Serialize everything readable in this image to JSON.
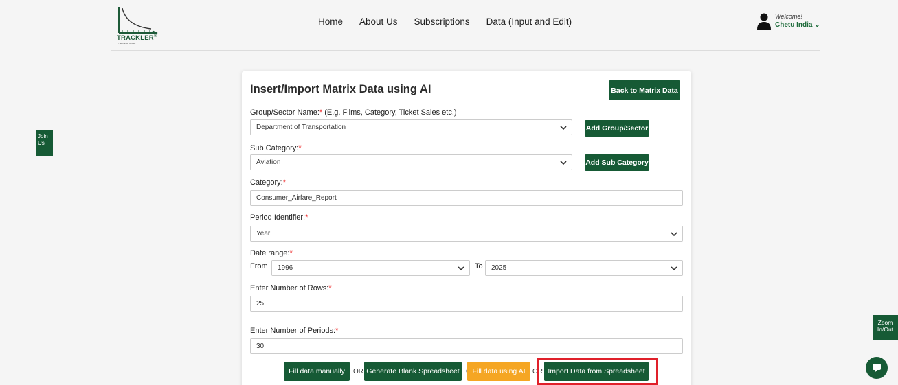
{
  "brand": {
    "logo_text": "TRACKLER",
    "tagline": "The tracker of data"
  },
  "nav": {
    "links": [
      "Home",
      "About Us",
      "Subscriptions",
      "Data (Input and Edit)"
    ]
  },
  "user": {
    "welcome": "Welcome!",
    "name": "Chetu India"
  },
  "side_tabs": {
    "join": "Join Us",
    "zoom": "Zoom In/Out"
  },
  "form": {
    "title": "Insert/Import Matrix Data using AI",
    "back_button": "Back to Matrix Data",
    "group": {
      "label": "Group/Sector Name:",
      "hint": " (E.g. Films, Category, Ticket Sales etc.)",
      "value": "Department of Transportation",
      "add_button": "Add Group/Sector"
    },
    "subcategory": {
      "label": "Sub Category:",
      "value": "Aviation",
      "add_button": "Add Sub Category"
    },
    "category": {
      "label": "Category:",
      "value": "Consumer_Airfare_Report"
    },
    "period": {
      "label": "Period Identifier:",
      "value": "Year"
    },
    "date_range": {
      "label": "Date range:",
      "from_label": "From",
      "from_value": "1996",
      "to_label": "To",
      "to_value": "2025"
    },
    "rows": {
      "label": "Enter Number of Rows:",
      "value": "25"
    },
    "periods": {
      "label": "Enter Number of Periods:",
      "value": "30"
    },
    "required_mark": "*",
    "actions": {
      "fill_manually": "Fill data manually",
      "or": "OR",
      "generate_blank": "Generate Blank Spreadsheet",
      "fill_ai": "Fill data using AI",
      "import": "Import Data from Spreadsheet"
    }
  },
  "colors": {
    "primary": "#165a35",
    "accent": "#f5a623",
    "required": "#e33333",
    "highlight": "#e0202a"
  }
}
